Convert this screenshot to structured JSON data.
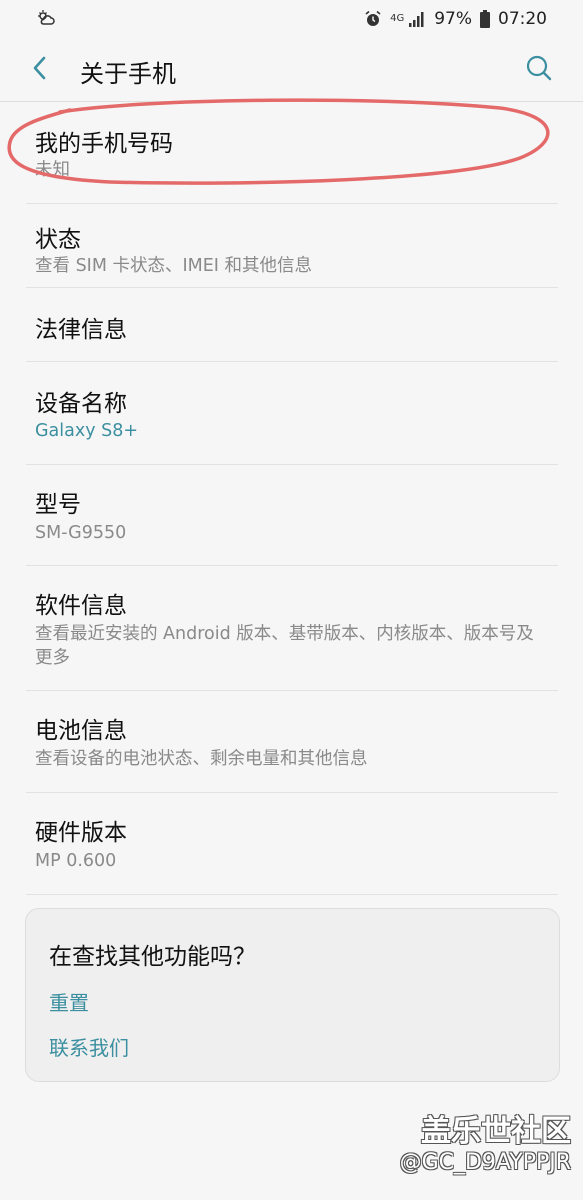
{
  "status_bar": {
    "left_icon": "weather-icon",
    "network_label": "4G",
    "battery": "97%",
    "time": "07:20"
  },
  "header": {
    "title": "关于手机",
    "back_icon": "back-arrow-icon",
    "search_icon": "search-icon"
  },
  "items": [
    {
      "title": "我的手机号码",
      "subtitle": "未知"
    },
    {
      "title": "状态",
      "subtitle": "查看 SIM 卡状态、IMEI 和其他信息"
    },
    {
      "title": "法律信息",
      "subtitle": ""
    },
    {
      "title": "设备名称",
      "subtitle": "Galaxy S8+"
    },
    {
      "title": "型号",
      "subtitle": "SM-G9550"
    },
    {
      "title": "软件信息",
      "subtitle": "查看最近安装的 Android 版本、基带版本、内核版本、版本号及更多"
    },
    {
      "title": "电池信息",
      "subtitle": "查看设备的电池状态、剩余电量和其他信息"
    },
    {
      "title": "硬件版本",
      "subtitle": "MP 0.600"
    }
  ],
  "card": {
    "title": "在查找其他功能吗？",
    "links": [
      "重置",
      "联系我们"
    ]
  },
  "watermark": {
    "brand": "盖乐世社区",
    "user": "@GC_D9AYPPJR"
  },
  "colors": {
    "accent": "#3c8fa0",
    "annotation": "#e46a6a",
    "background": "#f6f6f6"
  }
}
